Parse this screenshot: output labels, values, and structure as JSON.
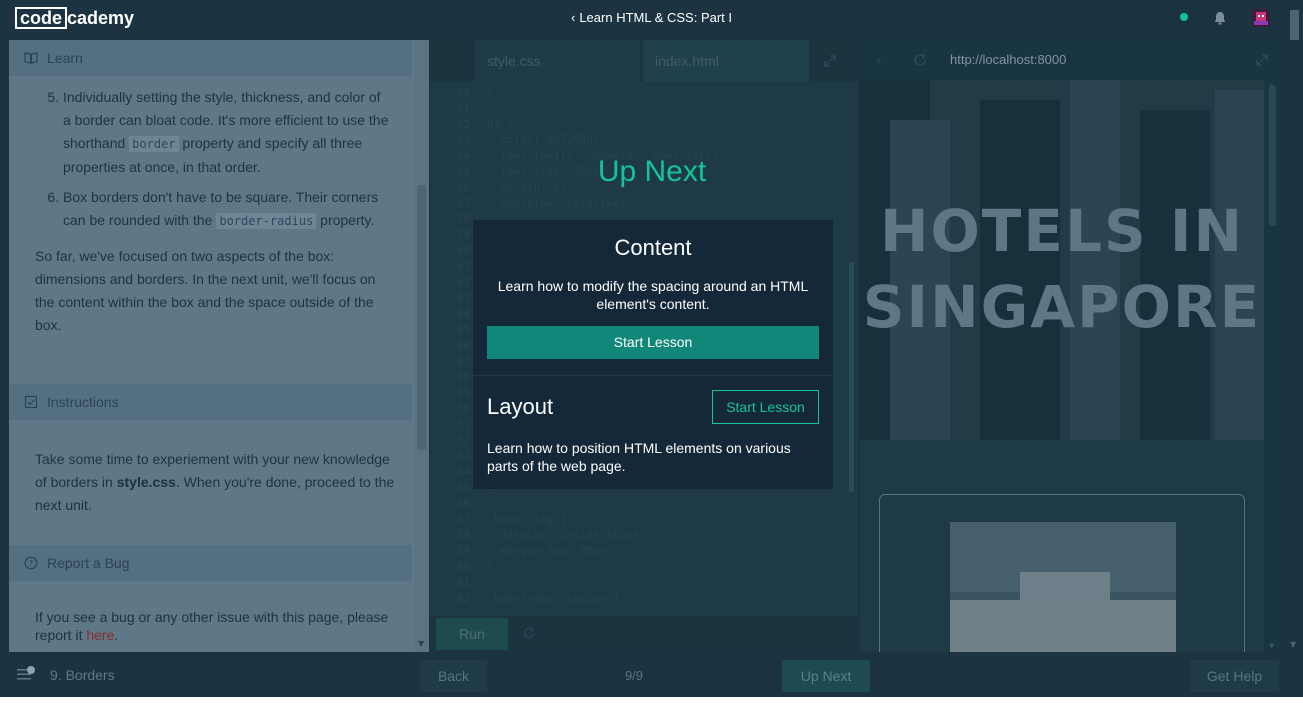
{
  "header": {
    "logo_left": "code",
    "logo_right": "cademy",
    "course_title": "Learn HTML & CSS: Part I",
    "accent": "#15c39a"
  },
  "learn": {
    "heading": "Learn",
    "items": [
      {
        "num": "5",
        "before": "Individually setting the style, thickness, and color of a border can bloat code. It's more efficient to use the shorthand ",
        "code": "border",
        "after": " property and specify all three properties at once, in that order."
      },
      {
        "num": "6",
        "before": "Box borders don't have to be square. Their corners can be rounded with the ",
        "code": "border-radius",
        "after": " property."
      }
    ],
    "paragraph": "So far, we've focused on two aspects of the box: dimensions and borders. In the next unit, we'll focus on the content within the box and the space outside of the box."
  },
  "instructions": {
    "heading": "Instructions",
    "text_before": "Take some time to experiement with your new knowledge of borders in ",
    "filename": "style.css",
    "text_after": ". When you're done, proceed to the next unit."
  },
  "bug": {
    "heading": "Report a Bug",
    "text_before": "If you see a bug or any other issue with this page, please report it ",
    "link": "here",
    "text_after": "."
  },
  "editor": {
    "tabs": [
      "style.css",
      "index.html"
    ],
    "run_label": "Run",
    "lines": [
      {
        "n": "30",
        "t": "}"
      },
      {
        "n": "31",
        "t": ""
      },
      {
        "n": "32",
        "t": "h3 {"
      },
      {
        "n": "33",
        "t": "  color: #072630;"
      },
      {
        "n": "34",
        "t": "  font-family: 'Oswald', sans-serif;"
      },
      {
        "n": "35",
        "t": "  font-size: 32px;"
      },
      {
        "n": "36",
        "t": "  margin: 0;"
      },
      {
        "n": "37",
        "t": "  position: relative;"
      },
      {
        "n": "38",
        "t": ""
      },
      {
        "n": "39",
        "t": ""
      },
      {
        "n": "40",
        "t": ""
      },
      {
        "n": "41",
        "t": ""
      },
      {
        "n": "42",
        "t": ""
      },
      {
        "n": "43",
        "t": ""
      },
      {
        "n": "44",
        "t": ""
      },
      {
        "n": "45",
        "t": ""
      },
      {
        "n": "46",
        "t": ""
      },
      {
        "n": "47",
        "t": ""
      },
      {
        "n": "48",
        "t": ""
      },
      {
        "n": "49",
        "t": ""
      },
      {
        "n": "50",
        "t": ""
      },
      {
        "n": "51",
        "t": ""
      },
      {
        "n": "52",
        "t": ""
      },
      {
        "n": "53",
        "t": ""
      },
      {
        "n": "54",
        "t": ""
      },
      {
        "n": "55",
        "t": "}"
      },
      {
        "n": "56",
        "t": ""
      },
      {
        "n": "57",
        "t": ".hotel-img {"
      },
      {
        "n": "58",
        "t": "  display: inline-block;"
      },
      {
        "n": "59",
        "t": "  margin-top: 20px;"
      },
      {
        "n": "60",
        "t": "}"
      },
      {
        "n": "61",
        "t": ""
      },
      {
        "n": "62",
        "t": ".hotel-description {"
      }
    ]
  },
  "up_next": {
    "title": "Up Next",
    "card1": {
      "title": "Content",
      "description": "Learn how to modify the spacing around an HTML element's content.",
      "button": "Start Lesson"
    },
    "card2": {
      "title": "Layout",
      "description": "Learn how to position HTML elements on various parts of the web page.",
      "button": "Start Lesson"
    }
  },
  "browser": {
    "url": "http://localhost:8000",
    "hero_line1": "HOTELS IN",
    "hero_line2": "SINGAPORE"
  },
  "bottom": {
    "lesson": "9. Borders",
    "back": "Back",
    "progress": "9/9",
    "next": "Up Next",
    "help": "Get Help"
  }
}
